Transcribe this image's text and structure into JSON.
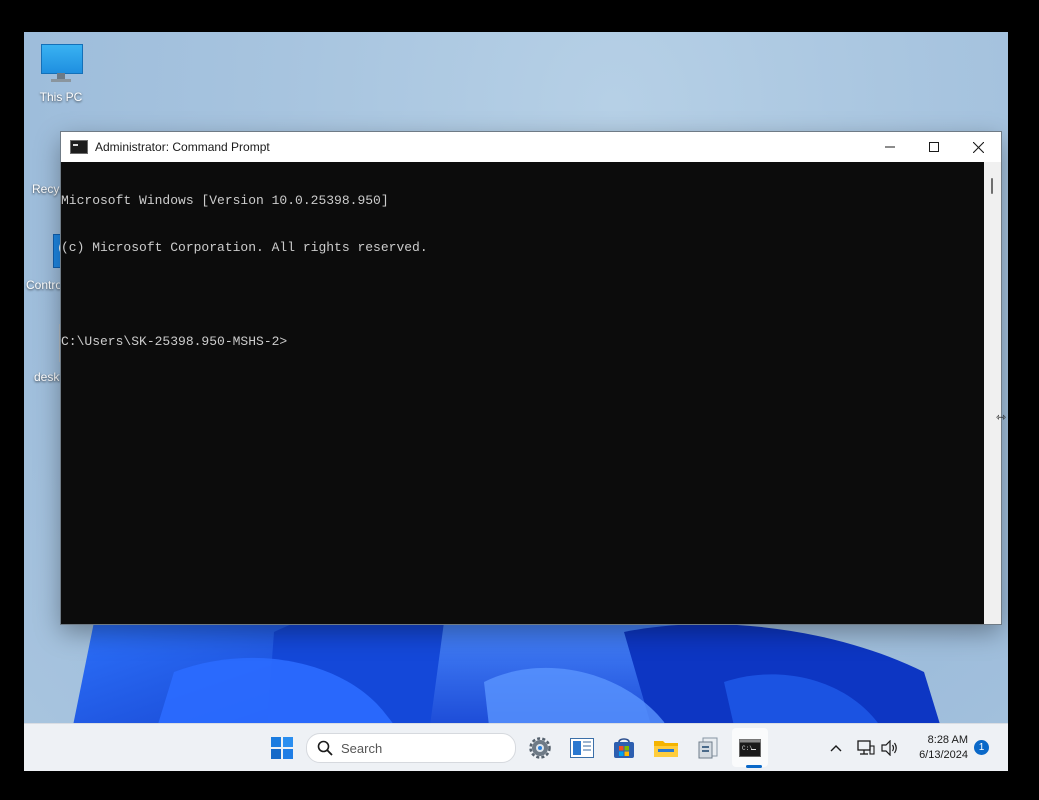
{
  "desktop": {
    "icons": [
      {
        "label": "This PC",
        "icon": "monitor-icon"
      },
      {
        "label": "Recyc",
        "icon": "recycle-bin-icon"
      },
      {
        "label": "Contro",
        "icon": "control-panel-icon"
      },
      {
        "label": "deskt",
        "icon": "desktop-file-icon"
      }
    ]
  },
  "window": {
    "title": "Administrator: Command Prompt",
    "console_lines": [
      "Microsoft Windows [Version 10.0.25398.950]",
      "(c) Microsoft Corporation. All rights reserved.",
      "",
      "C:\\Users\\SK-25398.950-MSHS-2>"
    ]
  },
  "taskbar": {
    "search_placeholder": "Search",
    "apps": [
      "start-icon",
      "settings-icon",
      "task-manager-icon",
      "store-icon",
      "file-explorer-icon",
      "archive-icon",
      "command-prompt-icon"
    ],
    "clock_time": "8:28 AM",
    "clock_date": "6/13/2024",
    "notification_count": "1"
  },
  "colors": {
    "console_bg": "#0c0c0c",
    "console_fg": "#cccccc",
    "accent": "#0a68c8"
  }
}
